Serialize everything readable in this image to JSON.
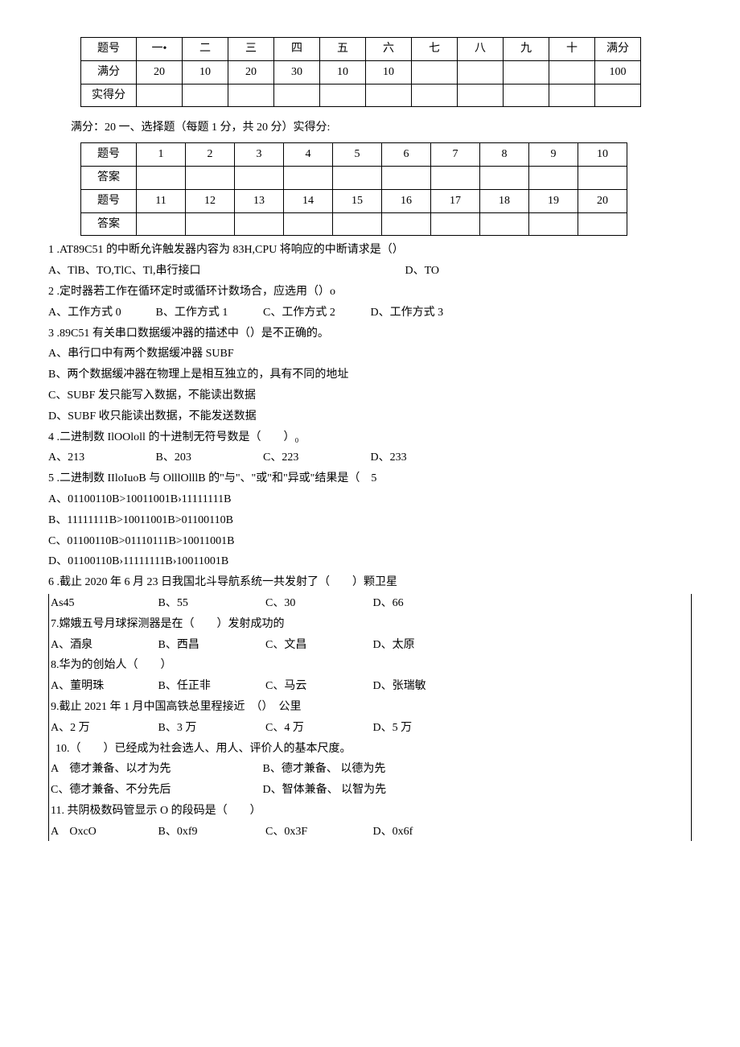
{
  "score_table": {
    "headers": [
      "题号",
      "一•",
      "二",
      "三",
      "四",
      "五",
      "六",
      "七",
      "八",
      "九",
      "十",
      "满分"
    ],
    "row_full": [
      "满分",
      "20",
      "10",
      "20",
      "30",
      "10",
      "10",
      "",
      "",
      "",
      "",
      "100"
    ],
    "row_actual": [
      "实得分",
      "",
      "",
      "",
      "",
      "",
      "",
      "",
      "",
      "",
      "",
      ""
    ]
  },
  "section_header": "满分：20 一、选择题（每题 1 分，共 20 分）实得分:",
  "answer_table": {
    "r1": [
      "题号",
      "1",
      "2",
      "3",
      "4",
      "5",
      "6",
      "7",
      "8",
      "9",
      "10"
    ],
    "r2": [
      "答案",
      "",
      "",
      "",
      "",
      "",
      "",
      "",
      "",
      "",
      ""
    ],
    "r3": [
      "题号",
      "11",
      "12",
      "13",
      "14",
      "15",
      "16",
      "17",
      "18",
      "19",
      "20"
    ],
    "r4": [
      "答案",
      "",
      "",
      "",
      "",
      "",
      "",
      "",
      "",
      "",
      ""
    ]
  },
  "q1": {
    "text": "1 .AT89C51 的中断允许触发器内容为 83H,CPU 将响应的中断请求是（）",
    "a": "A、TlB、TO,TlC、Tl,串行接口",
    "d": "D、TO"
  },
  "q2": {
    "text": "2 .定时器若工作在循环定时或循环计数场合，应选用（）o",
    "a": "A、工作方式 0",
    "b": "B、工作方式 1",
    "c": "C、工作方式 2",
    "d": "D、工作方式 3"
  },
  "q3": {
    "text": "3 .89C51 有关串口数据缓冲器的描述中（）是不正确的。",
    "a": "A、串行口中有两个数据缓冲器 SUBF",
    "b": "B、两个数据缓冲器在物理上是相互独立的，具有不同的地址",
    "c": "C、SUBF 发只能写入数据，不能读出数据",
    "d": "D、SUBF 收只能读出数据，不能发送数据"
  },
  "q4": {
    "text": "4 .二进制数 IlOOloll 的十进制无符号数是（　　）₀",
    "a": "A、213",
    "b": "B、203",
    "c": "C、223",
    "d": "D、233"
  },
  "q5": {
    "text": "5 .二进制数 IIloIuoB 与 OlllOlllB 的\"与\"、\"或\"和\"异或\"结果是（　5",
    "a": "A、01100110B>10011001B›11111111B",
    "b": "B、11111111B>10011001B>01100110B",
    "c": "C、01100110B>01110111B>10011001B",
    "d": "D、01100110B›11111111B›10011001B"
  },
  "q6": {
    "text": "6 .截止 2020 年 6 月 23 日我国北斗导航系统一共发射了（　　）颗卫星",
    "a": "As45",
    "b": "B、55",
    "c": "C、30",
    "d": "D、66"
  },
  "q7": {
    "text": "7.嫦娥五号月球探测器是在（　　）发射成功的",
    "a": "A、酒泉",
    "b": "B、西昌",
    "c": "C、文昌",
    "d": "D、太原"
  },
  "q8": {
    "text": "8.华为的创始人（　　）",
    "a": "A、董明珠",
    "b": "B、任正非",
    "c": "C、马云",
    "d": "D、张瑞敏"
  },
  "q9": {
    "text": "9.截止 2021 年 1 月中国高铁总里程接近　（）　公里",
    "a": "A、2 万",
    "b": "B、3 万",
    "c": "C、4 万",
    "d": "D、5 万"
  },
  "q10": {
    "text": "10.（　　）已经成为社会选人、用人、评价人的基本尺度。",
    "a": "A　德才兼备、以才为先",
    "b": "B、德才兼备、 以德为先",
    "c": "C、德才兼备、不分先后",
    "d": "D、智体兼备、 以智为先"
  },
  "q11": {
    "text": "11. 共阴极数码管显示 O 的段码是（　　）",
    "a": "A　OxcO",
    "b": "B、0xf9",
    "c": "C、0x3F",
    "d": "D、0x6f"
  }
}
